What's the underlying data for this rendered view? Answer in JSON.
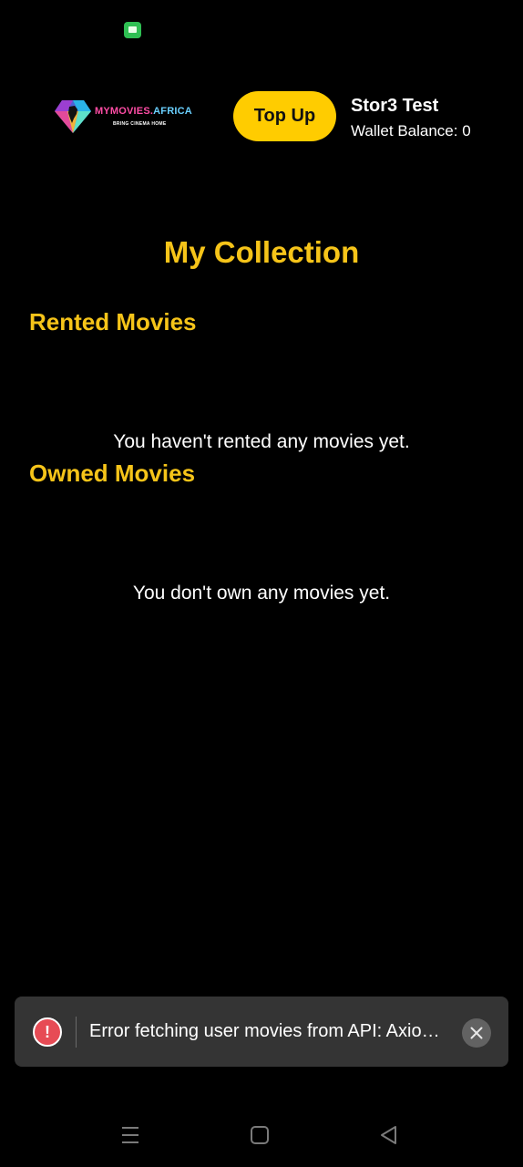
{
  "status_bar": {
    "icons": [
      "messaging-app-icon"
    ]
  },
  "header": {
    "logo": {
      "text_part1": "MYMOVIES.",
      "text_part2": "AFRICA",
      "tagline": "BRING CINEMA HOME"
    },
    "topup_label": "Top Up",
    "user_name": "Stor3 Test",
    "wallet_balance": "Wallet Balance: 0"
  },
  "page": {
    "title": "My Collection",
    "sections": {
      "rented": {
        "title": "Rented Movies",
        "empty_message": "You haven't rented any movies yet."
      },
      "owned": {
        "title": "Owned Movies",
        "empty_message": "You don't own any movies yet."
      }
    }
  },
  "toast": {
    "icon": "error-icon",
    "icon_glyph": "!",
    "message": "Error fetching user movies from API: AxiosError: Network Error",
    "close_icon": "close-icon"
  },
  "nav_bar": {
    "buttons": [
      "menu-icon",
      "home-icon",
      "back-icon"
    ]
  },
  "colors": {
    "background": "#000000",
    "accent_yellow": "#f6c419",
    "button_yellow": "#ffcc00",
    "toast_bg": "#343434",
    "error_red": "#e74b55"
  }
}
